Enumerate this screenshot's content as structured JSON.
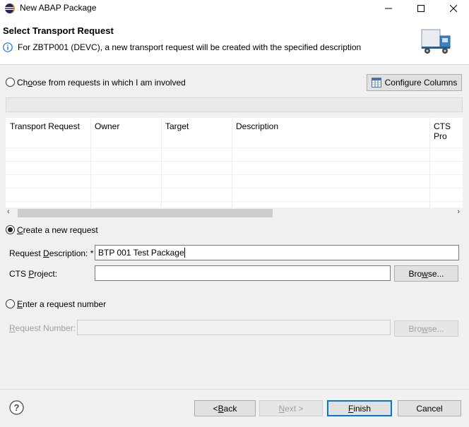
{
  "window": {
    "title": "New ABAP Package"
  },
  "header": {
    "title": "Select Transport Request",
    "message": "For ZBTP001 (DEVC), a new transport request will be created with the specified description"
  },
  "options": {
    "choose_label_pre": "Ch",
    "choose_label_u": "o",
    "choose_label_post": "ose from requests in which I am involved",
    "configure_columns_pre": "Confi",
    "configure_columns_u": "g",
    "configure_columns_post": "ure Columns",
    "create_label_pre": "",
    "create_label_u": "C",
    "create_label_post": "reate a new request",
    "enter_label_pre": "",
    "enter_label_u": "E",
    "enter_label_post": "nter a request number"
  },
  "table": {
    "columns": [
      "Transport Request",
      "Owner",
      "Target",
      "Description",
      "CTS Pro"
    ]
  },
  "form": {
    "request_description_pre": "Request ",
    "request_description_u": "D",
    "request_description_post": "escription: *",
    "request_description_value": "BTP 001 Test Package",
    "cts_project_pre": "CTS ",
    "cts_project_u": "P",
    "cts_project_post": "roject:",
    "cts_project_value": "",
    "browse_pre": "Bro",
    "browse_u": "w",
    "browse_post": "se...",
    "request_number_pre": "",
    "request_number_u": "R",
    "request_number_post": "equest Number:",
    "request_number_value": ""
  },
  "footer": {
    "back_pre": "< ",
    "back_u": "B",
    "back_post": "ack",
    "next_pre": "",
    "next_u": "N",
    "next_post": "ext >",
    "finish_pre": "",
    "finish_u": "F",
    "finish_post": "inish",
    "cancel": "Cancel"
  },
  "colors": {
    "info_blue": "#1e6fc7",
    "truck_blue": "#3b82c4",
    "default_button_border": "#0078d7"
  },
  "icons": {
    "app": "eclipse-icon",
    "info": "info-icon",
    "banner": "truck-icon",
    "help": "help-icon"
  }
}
